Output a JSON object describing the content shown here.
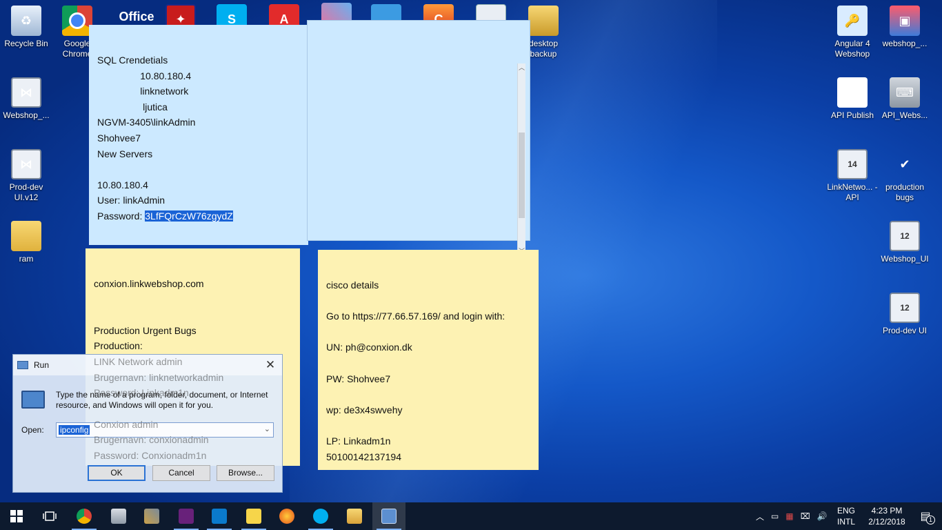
{
  "desktop_icons": {
    "recycle_bin": "Recycle Bin",
    "google_chrome": "Google Chrome",
    "office": "Office",
    "desktop_backup": "desktop backup",
    "webshop_left": "Webshop_...",
    "prod_dev_uiv12": "Prod-dev UI.v12",
    "ram": "ram",
    "angular4": "Angular 4 Webshop",
    "webshop_pack": "webshop_...",
    "api_publish": "API Publish",
    "api_webs": "API_Webs...",
    "linknetwork_api": "LinkNetwo... - API",
    "production_bugs": "production bugs",
    "webshop_ui": "Webshop_UI",
    "prod_dev_ui": "Prod-dev UI",
    "vs12_badge": "12",
    "vs14_badge": "14"
  },
  "note_sql": {
    "lines": [
      "SQL Crendetials",
      "                10.80.180.4",
      "                linknetwork",
      "                 ljutica",
      "NGVM-3405\\linkAdmin",
      "Shohvee7",
      "New Servers",
      "",
      "10.80.180.4",
      "User: linkAdmin"
    ],
    "password_label": "Password: ",
    "password_value": "3LfFQrCzW76zgydZ"
  },
  "note_conxion": {
    "lines": [
      "conxion.linkwebshop.com",
      "",
      "",
      "Production Urgent Bugs",
      "Production:"
    ],
    "ghost_lines": [
      "LINK Network admin",
      "Brugernavn: linknetworkadmin",
      "Password: Linkadm1n",
      "",
      "Conxion admin",
      "Brugernavn: conxionadmin",
      "Password: Conxionadm1n"
    ]
  },
  "note_cisco": {
    "lines": [
      "cisco details",
      "",
      "Go to https://77.66.57.169/ and login with:",
      "",
      "UN: ph@conxion.dk",
      "",
      "PW: Shohvee7",
      "",
      "wp: de3x4swvehy",
      "",
      "LP: Linkadm1n",
      "50100142137194"
    ]
  },
  "run_dialog": {
    "title": "Run",
    "message": "Type the name of a program, folder, document, or Internet resource, and Windows will open it for you.",
    "open_label": "Open:",
    "open_value": "ipconfig",
    "ok": "OK",
    "cancel": "Cancel",
    "browse": "Browse..."
  },
  "taskbar": {
    "language": "ENG",
    "layout": "INTL",
    "time": "4:23 PM",
    "date": "2/12/2018",
    "notifications": "1"
  },
  "colors": {
    "note_blue": "#cce9ff",
    "note_yellow": "#fdf2b3",
    "selection": "#1a63d6",
    "taskbar": "#0d1a2e"
  }
}
